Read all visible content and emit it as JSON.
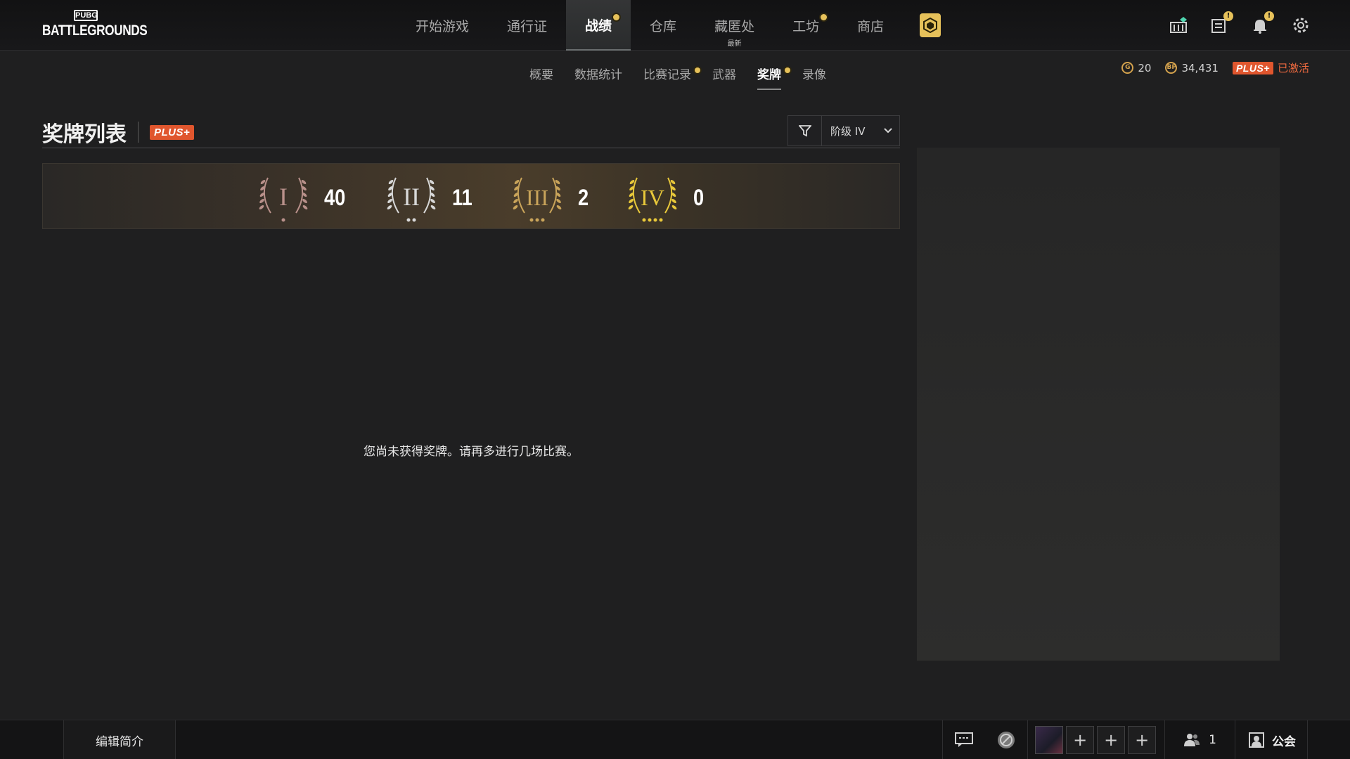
{
  "logo": {
    "small": "PUBG",
    "big": "BATTLEGROUNDS"
  },
  "main_nav": [
    {
      "label": "开始游戏"
    },
    {
      "label": "通行证"
    },
    {
      "label": "战绩",
      "active": true,
      "dot": true
    },
    {
      "label": "仓库"
    },
    {
      "label": "藏匿处",
      "sub": "最新"
    },
    {
      "label": "工坊",
      "dot": true
    },
    {
      "label": "商店"
    }
  ],
  "sub_nav": [
    {
      "label": "概要"
    },
    {
      "label": "数据统计"
    },
    {
      "label": "比赛记录",
      "dot": true
    },
    {
      "label": "武器"
    },
    {
      "label": "奖牌",
      "active": true,
      "dot": true
    },
    {
      "label": "录像"
    }
  ],
  "currency": {
    "g_coin": "20",
    "bp": "34,431",
    "plus_label": "PLUS+",
    "plus_status": "已激活"
  },
  "panel": {
    "title": "奖牌列表",
    "plus_label": "PLUS+",
    "filter_value": "阶级 IV"
  },
  "medals": [
    {
      "tier": "I",
      "count": "40",
      "color": "#b8908a"
    },
    {
      "tier": "II",
      "count": "11",
      "color": "#d8d8d8"
    },
    {
      "tier": "III",
      "count": "2",
      "color": "#c9a45a"
    },
    {
      "tier": "IV",
      "count": "0",
      "color": "#e8c83a"
    }
  ],
  "empty_message": "您尚未获得奖牌。请再多进行几场比赛。",
  "bottom": {
    "edit_bio": "编辑简介",
    "friends_count": "1",
    "guild": "公会",
    "slot_label": "+"
  },
  "colors": {
    "accent_gold": "#e6c15a",
    "plus_orange": "#e0562e"
  },
  "icons": [
    "bank-icon",
    "mission-icon",
    "bell-icon",
    "settings-icon",
    "chat-icon",
    "profile-emblem-icon",
    "friends-icon",
    "guild-icon",
    "filter-icon",
    "chevron-down-icon"
  ]
}
